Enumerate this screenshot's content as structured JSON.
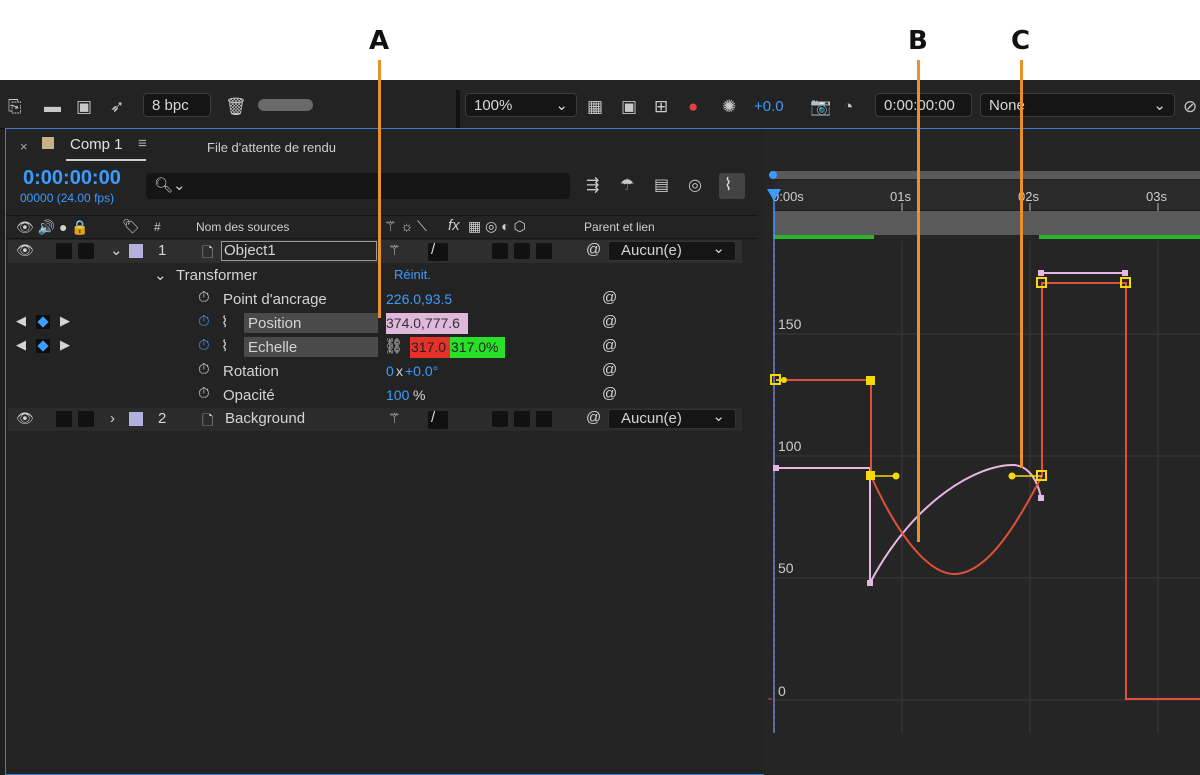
{
  "callouts": {
    "a": "A",
    "b": "B",
    "c": "C"
  },
  "toolbar": {
    "bit_depth": "8 bpc",
    "zoom": "100%",
    "exposure": "+0.0",
    "timecode": "0:00:00:00",
    "view_select": "None"
  },
  "panel": {
    "tab_title": "Comp 1",
    "tab_render_queue": "File d'attente de rendu",
    "current_time": "0:00:00:00",
    "frames_fps": "00000 (24.00 fps)",
    "search_placeholder": ""
  },
  "headers": {
    "number": "#",
    "source_name": "Nom des sources",
    "fx": "fx",
    "parent_link": "Parent et lien"
  },
  "layers": [
    {
      "number": "1",
      "name": "Object1",
      "parent": "Aucun(e)"
    },
    {
      "number": "2",
      "name": "Background",
      "parent": "Aucun(e)"
    }
  ],
  "transform": {
    "group_label": "Transformer",
    "reset_label": "Réinit.",
    "anchor_label": "Point d'ancrage",
    "anchor_value": "226.0,93.5",
    "position_label": "Position",
    "position_value": "374.0,777.6",
    "scale_label": "Echelle",
    "scale_x": "317.0",
    "scale_y": "317.0%",
    "rotation_label": "Rotation",
    "rotation_turns": "0",
    "rotation_x": "x",
    "rotation_deg": "+0.0°",
    "opacity_label": "Opacité",
    "opacity_value": "100",
    "opacity_unit": "%"
  },
  "graph": {
    "ruler_ticks": [
      "0:00s",
      "01s",
      "02s",
      "03s"
    ],
    "y_ticks": [
      "150",
      "100",
      "50",
      "0"
    ]
  },
  "colors": {
    "accent_blue": "#3d9bff",
    "position_highlight": "#e0b8dc",
    "scale_x_bg": "#e8302a",
    "scale_y_bg": "#27e027",
    "curve_red": "#e0503a",
    "curve_pink": "#e8b6e2",
    "keyframe_yellow": "#f5d90a",
    "callout_line": "#e8912a"
  }
}
